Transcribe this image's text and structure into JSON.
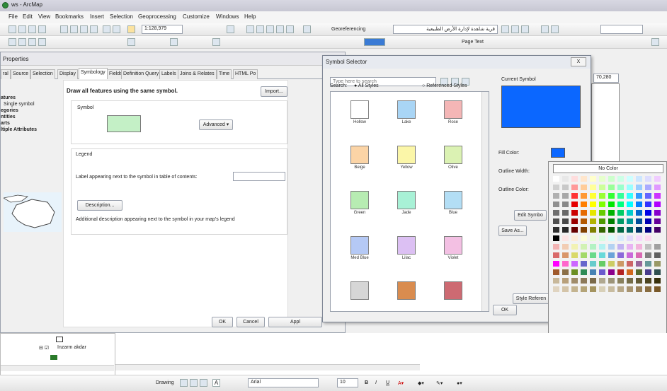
{
  "app": {
    "title": "ws - ArcMap"
  },
  "menu": [
    "File",
    "Edit",
    "View",
    "Bookmarks",
    "Insert",
    "Selection",
    "Geoprocessing",
    "Customize",
    "Windows",
    "Help"
  ],
  "toolbar": {
    "scale": "1:128,979",
    "georeferencing_label": "Georeferencing",
    "layer_combo": "قرية شاهدة لإدارة الأرض الطبيعية",
    "page_text": "Page Text",
    "num_field": "70,280"
  },
  "layer_props": {
    "title": "Properties",
    "tabs": [
      "ral",
      "Source",
      "Selection",
      "Display",
      "Symbology",
      "Fields",
      "Definition Query",
      "Labels",
      "Joins & Relates",
      "Time",
      "HTML Po"
    ],
    "active_tab": "Symbology",
    "show_items": [
      "atures",
      "Single symbol",
      "egories",
      "ntities",
      "arts",
      "ltiple Attributes"
    ],
    "heading": "Draw all features using the same symbol.",
    "import_label": "Import...",
    "symbol_label": "Symbol",
    "symbol_color": "#c4f0c6",
    "advanced_label": "Advanced",
    "legend_label": "Legend",
    "legend_text": "Label appearing next to the symbol in table of contents:",
    "description_btn": "Description...",
    "description_text": "Additional description appearing next to the symbol in your map's legend",
    "ok": "OK",
    "cancel": "Cancel",
    "apply": "Appl"
  },
  "symbol_selector": {
    "title": "Symbol Selector",
    "search_placeholder": "Type here to search",
    "search_label": "Search:",
    "all_styles": "All Styles",
    "referenced_styles": "Referenced Styles",
    "current_symbol_label": "Current Symbol",
    "current_color": "#0b67ff",
    "fill_color_label": "Fill Color:",
    "outline_width_label": "Outline Width:",
    "outline_color_label": "Outline Color:",
    "edit_symbol_btn": "Edit Symbo",
    "save_as_btn": "Save As...",
    "style_refs_btn": "Style Referen",
    "ok": "OK",
    "close": "X",
    "swatches": [
      {
        "name": "Hollow",
        "color": "#ffffff"
      },
      {
        "name": "Lake",
        "color": "#a9d5f5"
      },
      {
        "name": "Rose",
        "color": "#f4b6b6"
      },
      {
        "name": "Beige",
        "color": "#fbd4a6"
      },
      {
        "name": "Yellow",
        "color": "#fbf6a8"
      },
      {
        "name": "Olive",
        "color": "#dbf2b3"
      },
      {
        "name": "Green",
        "color": "#b7ecb2"
      },
      {
        "name": "Jade",
        "color": "#a8f1d6"
      },
      {
        "name": "Blue",
        "color": "#b3def5"
      },
      {
        "name": "Med Blue",
        "color": "#b5c9f5"
      },
      {
        "name": "Lilac",
        "color": "#dcc0f3"
      },
      {
        "name": "Violet",
        "color": "#f3c0e3"
      },
      {
        "name": "",
        "color": "#d6d6d6"
      },
      {
        "name": "",
        "color": "#d98c4f"
      },
      {
        "name": "",
        "color": "#cd6a72"
      }
    ]
  },
  "palette": {
    "no_color": "No Color",
    "columns": 12,
    "colors": [
      "#ffffff",
      "#e8e8e8",
      "#ffdddd",
      "#ffe6cc",
      "#ffffcc",
      "#e6ffcc",
      "#ccffcc",
      "#ccffe6",
      "#ccffff",
      "#cce6ff",
      "#ddddff",
      "#f0ccff",
      "#d0d0d0",
      "#c8c8c8",
      "#ff9999",
      "#ffcc99",
      "#ffff99",
      "#ccff99",
      "#99ff99",
      "#99ffcc",
      "#99ffff",
      "#99ccff",
      "#aaaaff",
      "#e099ff",
      "#b0b0b0",
      "#a8a8a8",
      "#ff3333",
      "#ff9933",
      "#ffff33",
      "#99ff33",
      "#33ff33",
      "#33ff99",
      "#33ffff",
      "#3399ff",
      "#6666ff",
      "#cc33ff",
      "#909090",
      "#888888",
      "#e60000",
      "#ff7f00",
      "#ffff00",
      "#7fff00",
      "#00e600",
      "#00ff7f",
      "#00ffff",
      "#007fff",
      "#3333ff",
      "#b200ff",
      "#707070",
      "#686868",
      "#cc0000",
      "#e66b00",
      "#e6e600",
      "#66cc00",
      "#00b300",
      "#00cc66",
      "#00cccc",
      "#0066cc",
      "#0000e6",
      "#8800cc",
      "#505050",
      "#484848",
      "#990000",
      "#b35900",
      "#b3b300",
      "#4d9900",
      "#008000",
      "#009966",
      "#009999",
      "#004d99",
      "#0000b3",
      "#660099",
      "#303030",
      "#282828",
      "#660000",
      "#804000",
      "#808000",
      "#336600",
      "#005500",
      "#006644",
      "#006666",
      "#003366",
      "#000080",
      "#440066",
      "#000000",
      "#fce4e4",
      "#fcebd9",
      "#fcfcd9",
      "#e9fcd9",
      "#d9fce3",
      "#d9fcfc",
      "#d9ebfc",
      "#e3d9fc",
      "#f6d9fc",
      "#fcd9ee",
      "#f0f0f0",
      "#f2b3b3",
      "#f2ccb3",
      "#f2f2b3",
      "#d2f2b3",
      "#b3f2c3",
      "#b3f2f2",
      "#b3d2f2",
      "#c3b3f2",
      "#e8b3f2",
      "#f2b3dc",
      "#c0c0c0",
      "#a0a0a0",
      "#d96a6a",
      "#d9966a",
      "#d9d96a",
      "#a3d96a",
      "#6ad98a",
      "#6ad9d9",
      "#6aa3d9",
      "#8a6ad9",
      "#c96ad9",
      "#d96ab3",
      "#808080",
      "#606060",
      "#ff00ff",
      "#ff66cc",
      "#cc66ff",
      "#6666cc",
      "#66cccc",
      "#66cc66",
      "#cccc66",
      "#cc9966",
      "#cc6666",
      "#996699",
      "#669999",
      "#999966",
      "#a05a2c",
      "#8b6f47",
      "#6b8e23",
      "#2e8b57",
      "#4682b4",
      "#6a5acd",
      "#8b008b",
      "#b22222",
      "#d2691e",
      "#556b2f",
      "#483d8b",
      "#2f4f4f",
      "#c8b89a",
      "#b8a07a",
      "#a08c6a",
      "#8c7a5a",
      "#7a6a4a",
      "#b0a890",
      "#9c9478",
      "#88805c",
      "#746c48",
      "#605834",
      "#4c4420",
      "#38300c",
      "#e0d4c0",
      "#d4c4a8",
      "#c4b490",
      "#b4a478",
      "#a49460",
      "#d8d0b8",
      "#c8bca0",
      "#b8a888",
      "#a89470",
      "#988058",
      "#886c40",
      "#785828"
    ]
  },
  "toc": {
    "layer_name": "Inzarm akdar"
  },
  "drawing": {
    "label": "Drawing",
    "font": "Arial",
    "size": "10"
  }
}
